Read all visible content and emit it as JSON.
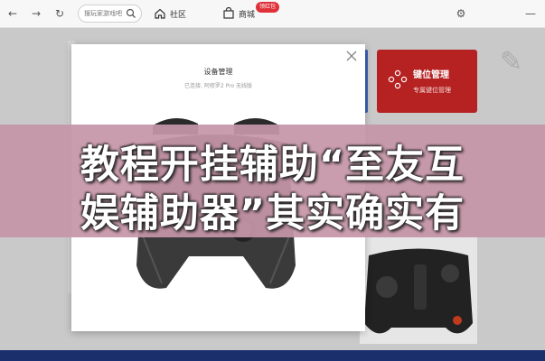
{
  "browser": {
    "back_icon": "←",
    "forward_icon": "→",
    "refresh_icon": "↻",
    "search_placeholder": "搜玩家游戏吧",
    "tabs": [
      {
        "label": "社区",
        "icon": "home-icon"
      },
      {
        "label": "商城",
        "icon": "shop-icon"
      }
    ],
    "badge": "领红包",
    "settings_icon": "⚙",
    "minimize_icon": "—"
  },
  "app": {
    "key_card": {
      "title": "键位管理",
      "subtitle": "专属键位管理"
    }
  },
  "modal": {
    "title": "设备管理",
    "subtitle": "已连接: 阿修罗2 Pro 无线版"
  },
  "banner": {
    "line1": "教程开挂辅助“至友互",
    "line2": "娱辅助器”其实确实有"
  },
  "colors": {
    "red_card": "#b62121",
    "blue_card": "#3d5fb3",
    "banner": "#c696a8"
  }
}
